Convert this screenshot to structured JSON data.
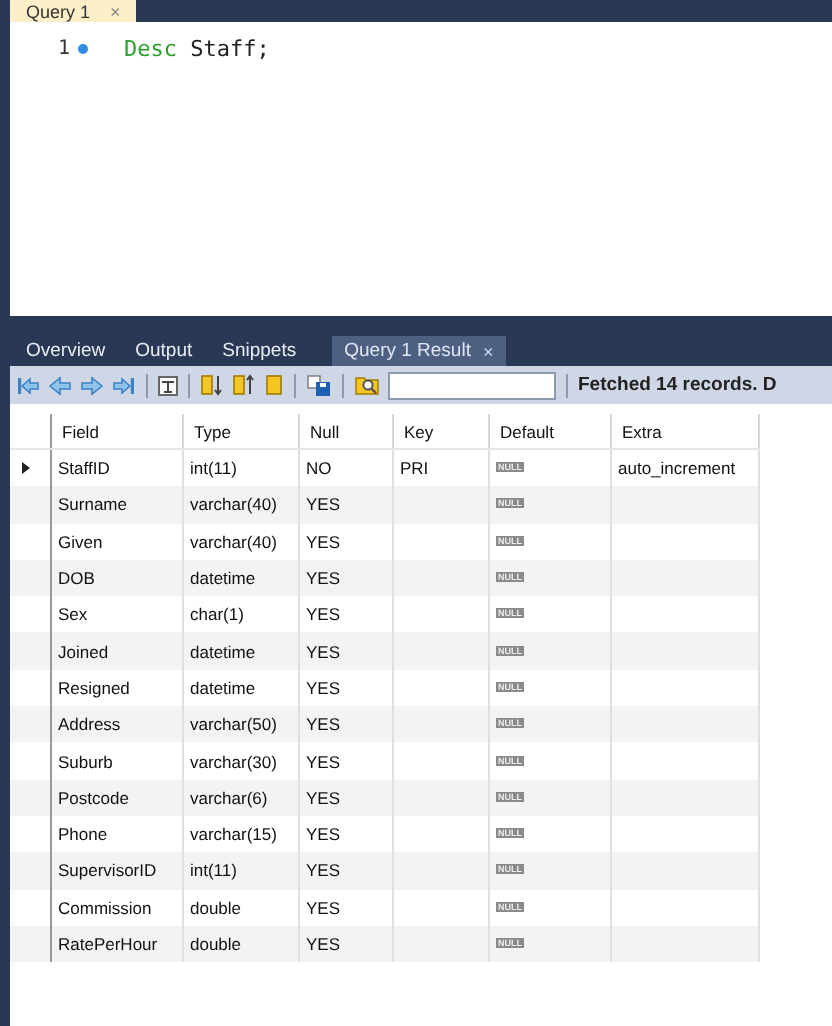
{
  "editor_tab": {
    "label": "Query 1",
    "close": "×"
  },
  "editor": {
    "lines": [
      {
        "number": "1",
        "marked": true,
        "tokens": [
          {
            "kind": "keyword",
            "text": "Desc"
          },
          {
            "kind": "plain",
            "text": " Staff;"
          }
        ]
      }
    ]
  },
  "result_tabs": [
    {
      "label": "Overview",
      "selected": false
    },
    {
      "label": "Output",
      "selected": false
    },
    {
      "label": "Snippets",
      "selected": false
    },
    {
      "label": "Query 1 Result",
      "selected": true,
      "close": "×"
    }
  ],
  "toolbar": {
    "status": "Fetched 14 records. D"
  },
  "table": {
    "columns": [
      "Field",
      "Type",
      "Null",
      "Key",
      "Default",
      "Extra"
    ],
    "rows": [
      {
        "selected": true,
        "cells": [
          "StaffID",
          "int(11)",
          "NO",
          "PRI",
          "NULL",
          "auto_increment"
        ]
      },
      {
        "selected": false,
        "cells": [
          "Surname",
          "varchar(40)",
          "YES",
          "",
          "NULL",
          ""
        ]
      },
      {
        "selected": false,
        "cells": [
          "Given",
          "varchar(40)",
          "YES",
          "",
          "NULL",
          ""
        ]
      },
      {
        "selected": false,
        "cells": [
          "DOB",
          "datetime",
          "YES",
          "",
          "NULL",
          ""
        ]
      },
      {
        "selected": false,
        "cells": [
          "Sex",
          "char(1)",
          "YES",
          "",
          "NULL",
          ""
        ]
      },
      {
        "selected": false,
        "cells": [
          "Joined",
          "datetime",
          "YES",
          "",
          "NULL",
          ""
        ]
      },
      {
        "selected": false,
        "cells": [
          "Resigned",
          "datetime",
          "YES",
          "",
          "NULL",
          ""
        ]
      },
      {
        "selected": false,
        "cells": [
          "Address",
          "varchar(50)",
          "YES",
          "",
          "NULL",
          ""
        ]
      },
      {
        "selected": false,
        "cells": [
          "Suburb",
          "varchar(30)",
          "YES",
          "",
          "NULL",
          ""
        ]
      },
      {
        "selected": false,
        "cells": [
          "Postcode",
          "varchar(6)",
          "YES",
          "",
          "NULL",
          ""
        ]
      },
      {
        "selected": false,
        "cells": [
          "Phone",
          "varchar(15)",
          "YES",
          "",
          "NULL",
          ""
        ]
      },
      {
        "selected": false,
        "cells": [
          "SupervisorID",
          "int(11)",
          "YES",
          "",
          "NULL",
          ""
        ]
      },
      {
        "selected": false,
        "cells": [
          "Commission",
          "double",
          "YES",
          "",
          "NULL",
          ""
        ]
      },
      {
        "selected": false,
        "cells": [
          "RatePerHour",
          "double",
          "YES",
          "",
          "NULL",
          ""
        ]
      }
    ]
  }
}
